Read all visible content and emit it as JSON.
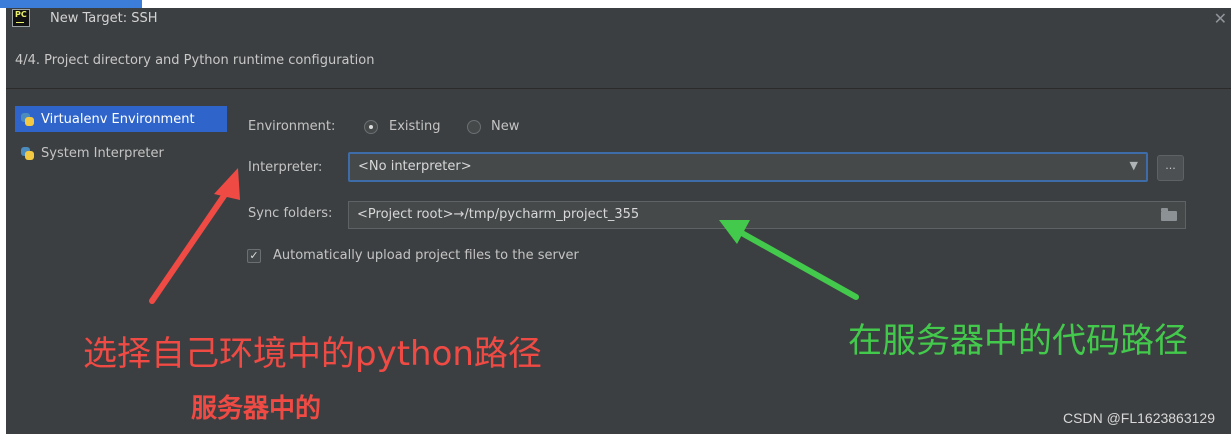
{
  "window": {
    "title": "New Target: SSH",
    "step": "4/4. Project directory and Python runtime configuration",
    "app_icon_text": "PC",
    "close_glyph": "✕"
  },
  "left_panel": {
    "items": [
      {
        "label": "Virtualenv Environment",
        "icon": "python-icon",
        "selected": true
      },
      {
        "label": "System Interpreter",
        "icon": "python-icon",
        "selected": false
      }
    ]
  },
  "form": {
    "environment_label": "Environment:",
    "environment_options": [
      {
        "label": "Existing",
        "selected": true
      },
      {
        "label": "New",
        "selected": false
      }
    ],
    "interpreter_label": "Interpreter:",
    "interpreter_value": "<No interpreter>",
    "browse_label": "...",
    "sync_label": "Sync folders:",
    "sync_value": "<Project root>→/tmp/pycharm_project_355",
    "auto_upload_label": "Automatically upload project files to the server",
    "auto_upload_checked": true
  },
  "annotations": {
    "red_main": "选择自己环境中的python路径",
    "red_sub": "服务器中的",
    "green": "在服务器中的代码路径",
    "red_color": "#f04a44",
    "green_color": "#43c94b"
  },
  "watermark": "CSDN @FL1623863129",
  "colors": {
    "dialog_bg": "#3c3f41",
    "selection": "#2f65ca",
    "focus_border": "#3d6ca8"
  }
}
